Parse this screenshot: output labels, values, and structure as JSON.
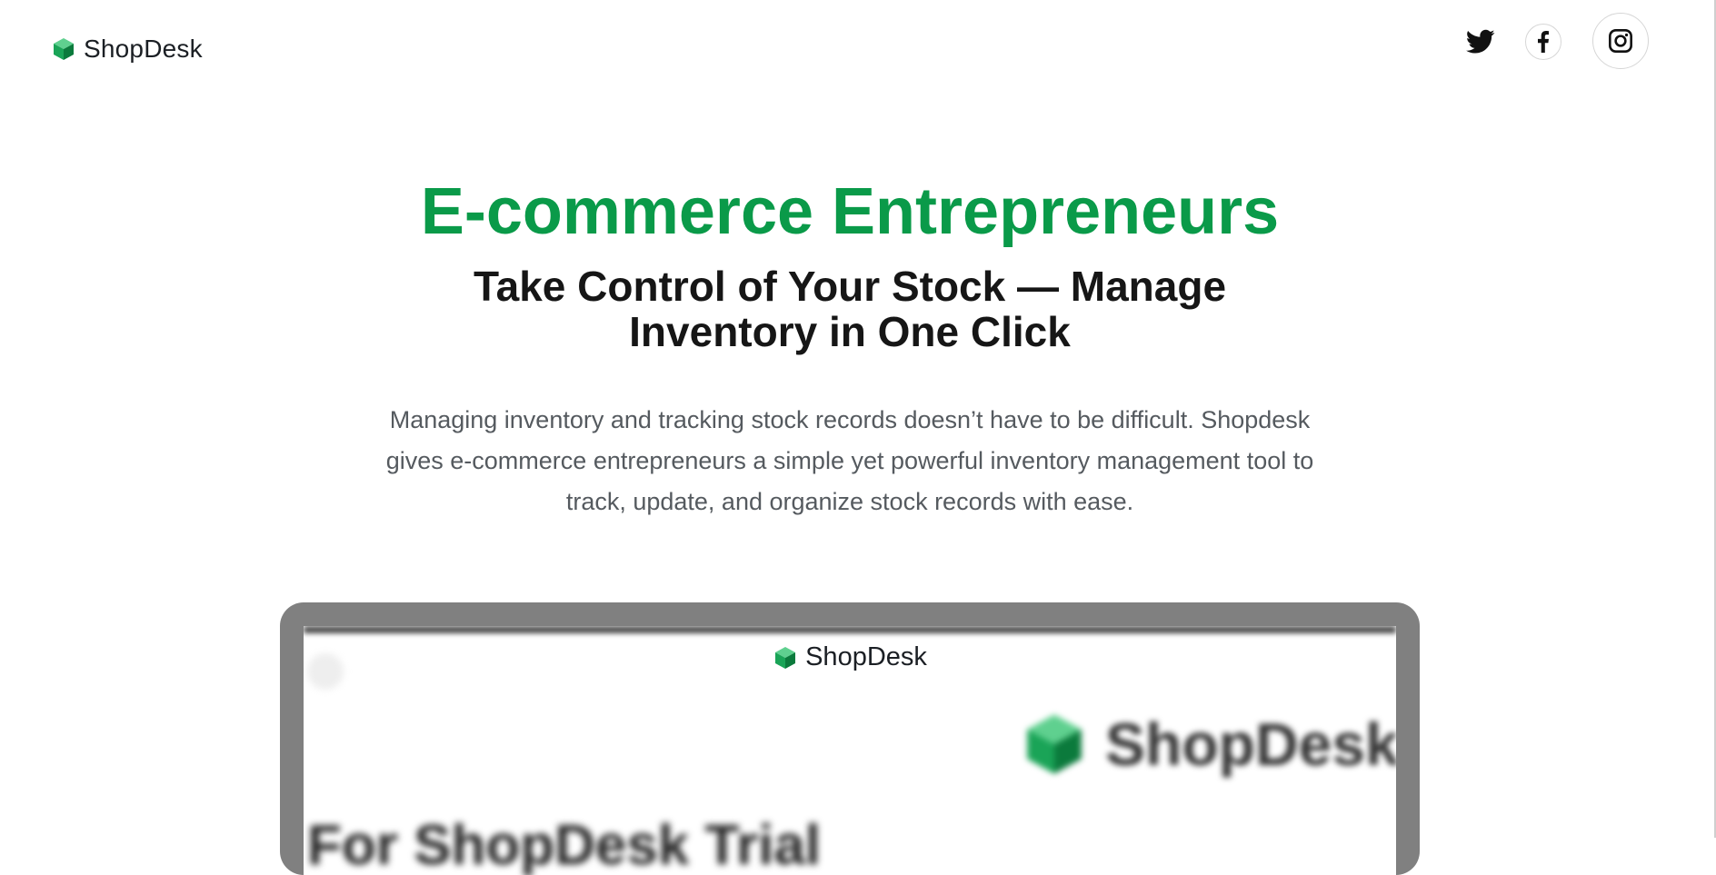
{
  "header": {
    "brand_name": "ShopDesk",
    "logo_icon": "cube-icon",
    "socials": [
      {
        "name": "twitter",
        "icon": "twitter-icon"
      },
      {
        "name": "facebook",
        "icon": "facebook-icon"
      },
      {
        "name": "instagram",
        "icon": "instagram-icon"
      }
    ]
  },
  "hero": {
    "title": "E-commerce Entrepreneurs",
    "subtitle": "Take Control of Your Stock — Manage Inventory in One Click",
    "description": "Managing inventory and tracking stock records doesn’t have to be difficult. Shopdesk gives e-commerce entrepreneurs a simple yet powerful inventory management tool to track, update, and organize stock records with ease."
  },
  "preview": {
    "brand_name": "ShopDesk",
    "big_logo_text": "ShopDesk",
    "blurred_heading": "For ShopDesk Trial"
  },
  "colors": {
    "accent": "#0a9a49",
    "heading": "#161616",
    "body_text": "#555a5f",
    "frame": "#808080"
  }
}
